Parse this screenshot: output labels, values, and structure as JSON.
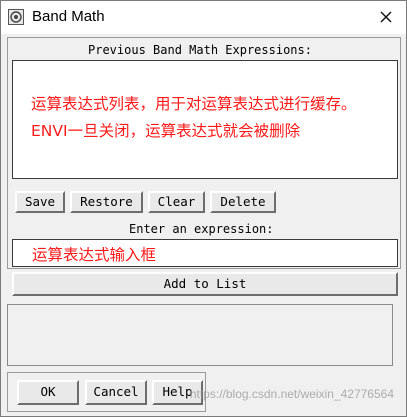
{
  "window": {
    "title": "Band Math"
  },
  "icons": {
    "app": "envi-app-icon",
    "close": "close-icon"
  },
  "expressions": {
    "label": "Previous Band Math Expressions:",
    "annotation": "运算表达式列表，用于对运算表达式进行缓存。ENVI一旦关闭，运算表达式就会被删除"
  },
  "list_buttons": {
    "save": "Save",
    "restore": "Restore",
    "clear": "Clear",
    "delete": "Delete"
  },
  "entry": {
    "label": "Enter an expression:",
    "annotation": "运算表达式输入框",
    "add_label": "Add to List"
  },
  "footer_buttons": {
    "ok": "OK",
    "cancel": "Cancel",
    "help": "Help"
  },
  "watermark": "https://blog.csdn.net/weixin_42776564",
  "colors": {
    "annotation": "#ff1a1a",
    "window_bg": "#f0f0f0"
  }
}
